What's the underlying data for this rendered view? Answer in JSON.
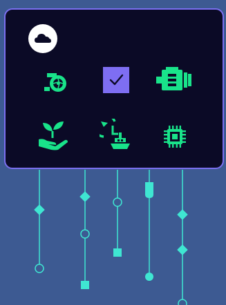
{
  "colors": {
    "background": "#3d5a92",
    "panel_background": "#0b0a26",
    "panel_border": "#7b6ff0",
    "accent_green": "#19e38a",
    "connector_line": "#3fe6d2",
    "checkbox_fill": "#7e6ef2",
    "cloud_badge": "#ffffff"
  },
  "panel": {
    "icons": [
      {
        "name": "cloud-icon",
        "interactable": true
      },
      {
        "name": "turbocharger-icon",
        "interactable": false
      },
      {
        "name": "checkbox-checked-icon",
        "interactable": true
      },
      {
        "name": "engine-icon",
        "interactable": false
      },
      {
        "name": "plant-in-hand-icon",
        "interactable": false
      },
      {
        "name": "timed-upload-icon",
        "interactable": false
      },
      {
        "name": "cpu-chip-icon",
        "interactable": false
      }
    ],
    "checkbox": {
      "checked": true
    }
  },
  "connectors": [
    {
      "name": "connector-1",
      "markers": [
        "diamond",
        "circle"
      ]
    },
    {
      "name": "connector-2",
      "markers": [
        "diamond",
        "circle",
        "square"
      ]
    },
    {
      "name": "connector-3",
      "markers": [
        "circle",
        "square"
      ]
    },
    {
      "name": "connector-4",
      "markers": [
        "plug",
        "dot"
      ]
    },
    {
      "name": "connector-5",
      "markers": [
        "diamond",
        "diamond",
        "circle"
      ]
    }
  ]
}
